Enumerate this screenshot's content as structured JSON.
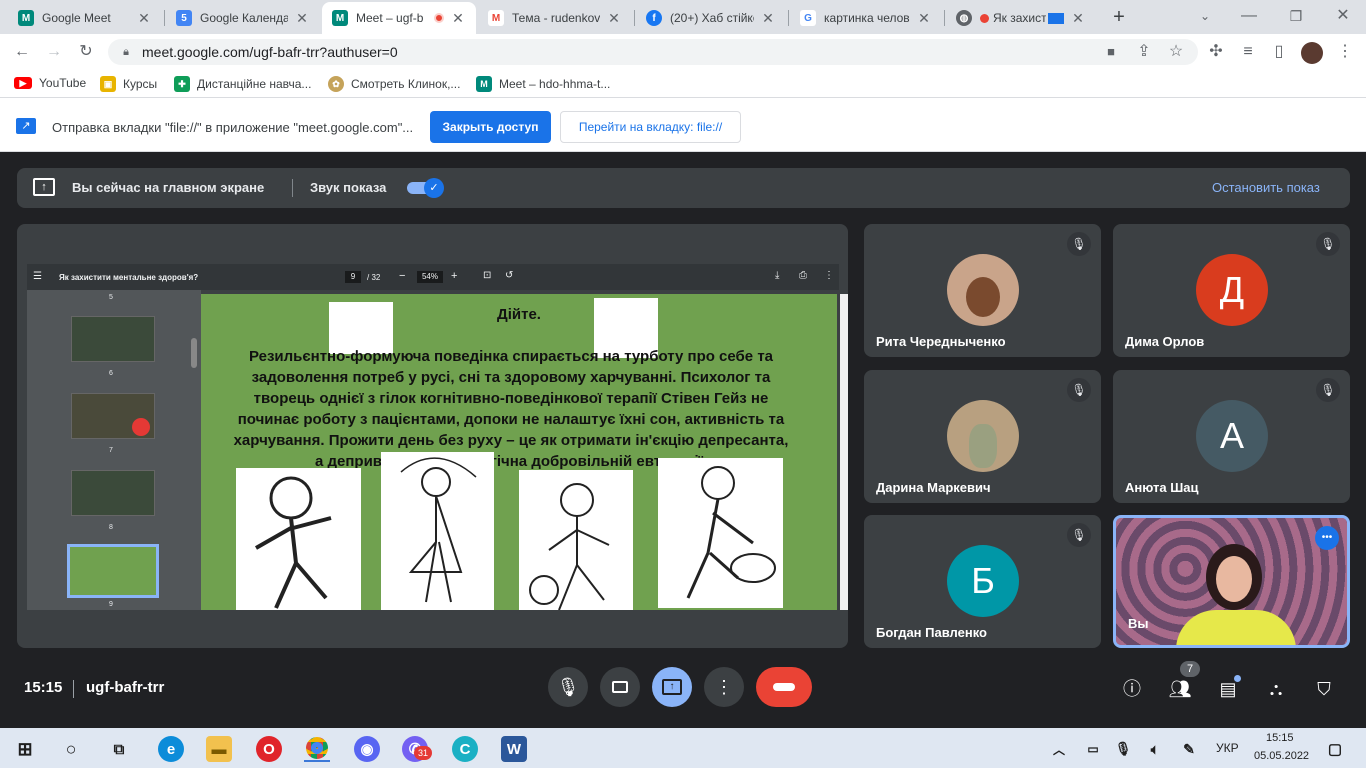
{
  "tabs": [
    {
      "title": "Google Meet",
      "fav_color": "#00897b",
      "fav": "M"
    },
    {
      "title": "Google Календар",
      "fav_color": "#4285f4",
      "fav": "5"
    },
    {
      "title": "Meet – ugf-b",
      "fav_color": "#00897b",
      "fav": "M"
    },
    {
      "title": "Тема - rudenkov",
      "fav_color": "#ea4335",
      "fav": "M"
    },
    {
      "title": "(20+) Хаб стійкої",
      "fav_color": "#1877f2",
      "fav": "f"
    },
    {
      "title": "картинка челове",
      "fav_color": "#ffffff",
      "fav": "G"
    },
    {
      "title": "Як захисти",
      "fav_color": "#5f6368",
      "fav": "◍"
    }
  ],
  "toolbar": {
    "url": "meet.google.com/ugf-bafr-trr?authuser=0"
  },
  "bookmarks": [
    {
      "label": "YouTube",
      "color": "#ff0000",
      "icon": "▶"
    },
    {
      "label": "Курсы",
      "color": "#e8b400",
      "icon": "▣"
    },
    {
      "label": "Дистанційне навча...",
      "color": "#0f9d58",
      "icon": "✚"
    },
    {
      "label": "Смотреть Клинок,...",
      "color": "#c5a35a",
      "icon": "✿"
    },
    {
      "label": "Meet – hdo-hhma-t...",
      "color": "#00897b",
      "icon": "M"
    }
  ],
  "infobar": {
    "message": "Отправка вкладки \"file://\" в приложение \"meet.google.com\"...",
    "share_button": "Закрыть доступ",
    "goto_button": "Перейти на вкладку: file://"
  },
  "present_bar": {
    "status": "Вы сейчас на главном экране",
    "sound_label": "Звук показа",
    "stop_label": "Остановить показ"
  },
  "pdf": {
    "title": "Як захистити ментальне здоров'я?",
    "page": "9",
    "pages": "/ 32",
    "zoom": "54%",
    "thumb_numbers": [
      "5",
      "6",
      "7",
      "8",
      "9"
    ],
    "slide_title": "Дійте.",
    "slide_text": "Резильєнтно-формуюча поведінка спирається на турботу про себе та задоволення потреб у русі, сні та здоровому харчуванні. Психолог та творець однієї з гілок когнітивно-поведінкової терапії Стівен Гейз не починає роботу з пацієнтами, допоки не налаштує їхні сон, активність та харчування. Прожити день без руху – це як отримати ін'єкцію депресанта, а депривація сну аналогічна добровільній евтаназії."
  },
  "participants": [
    {
      "name": "Рита Чередныченко",
      "initial": "",
      "color": "#c9a48a"
    },
    {
      "name": "Дима Орлов",
      "initial": "Д",
      "color": "#d93c1e"
    },
    {
      "name": "Дарина Маркевич",
      "initial": "",
      "color": "#b8a080"
    },
    {
      "name": "Анюта Шац",
      "initial": "А",
      "color": "#455a64"
    },
    {
      "name": "Богдан Павленко",
      "initial": "Б",
      "color": "#0097a7"
    },
    {
      "name": "Вы",
      "initial": "",
      "color": "#8a5a7a"
    }
  ],
  "meeting": {
    "time": "15:15",
    "code": "ugf-bafr-trr",
    "people_count": "7"
  },
  "taskbar": {
    "lang": "УКР",
    "time": "15:15",
    "date": "05.05.2022",
    "viber_badge": "31"
  }
}
